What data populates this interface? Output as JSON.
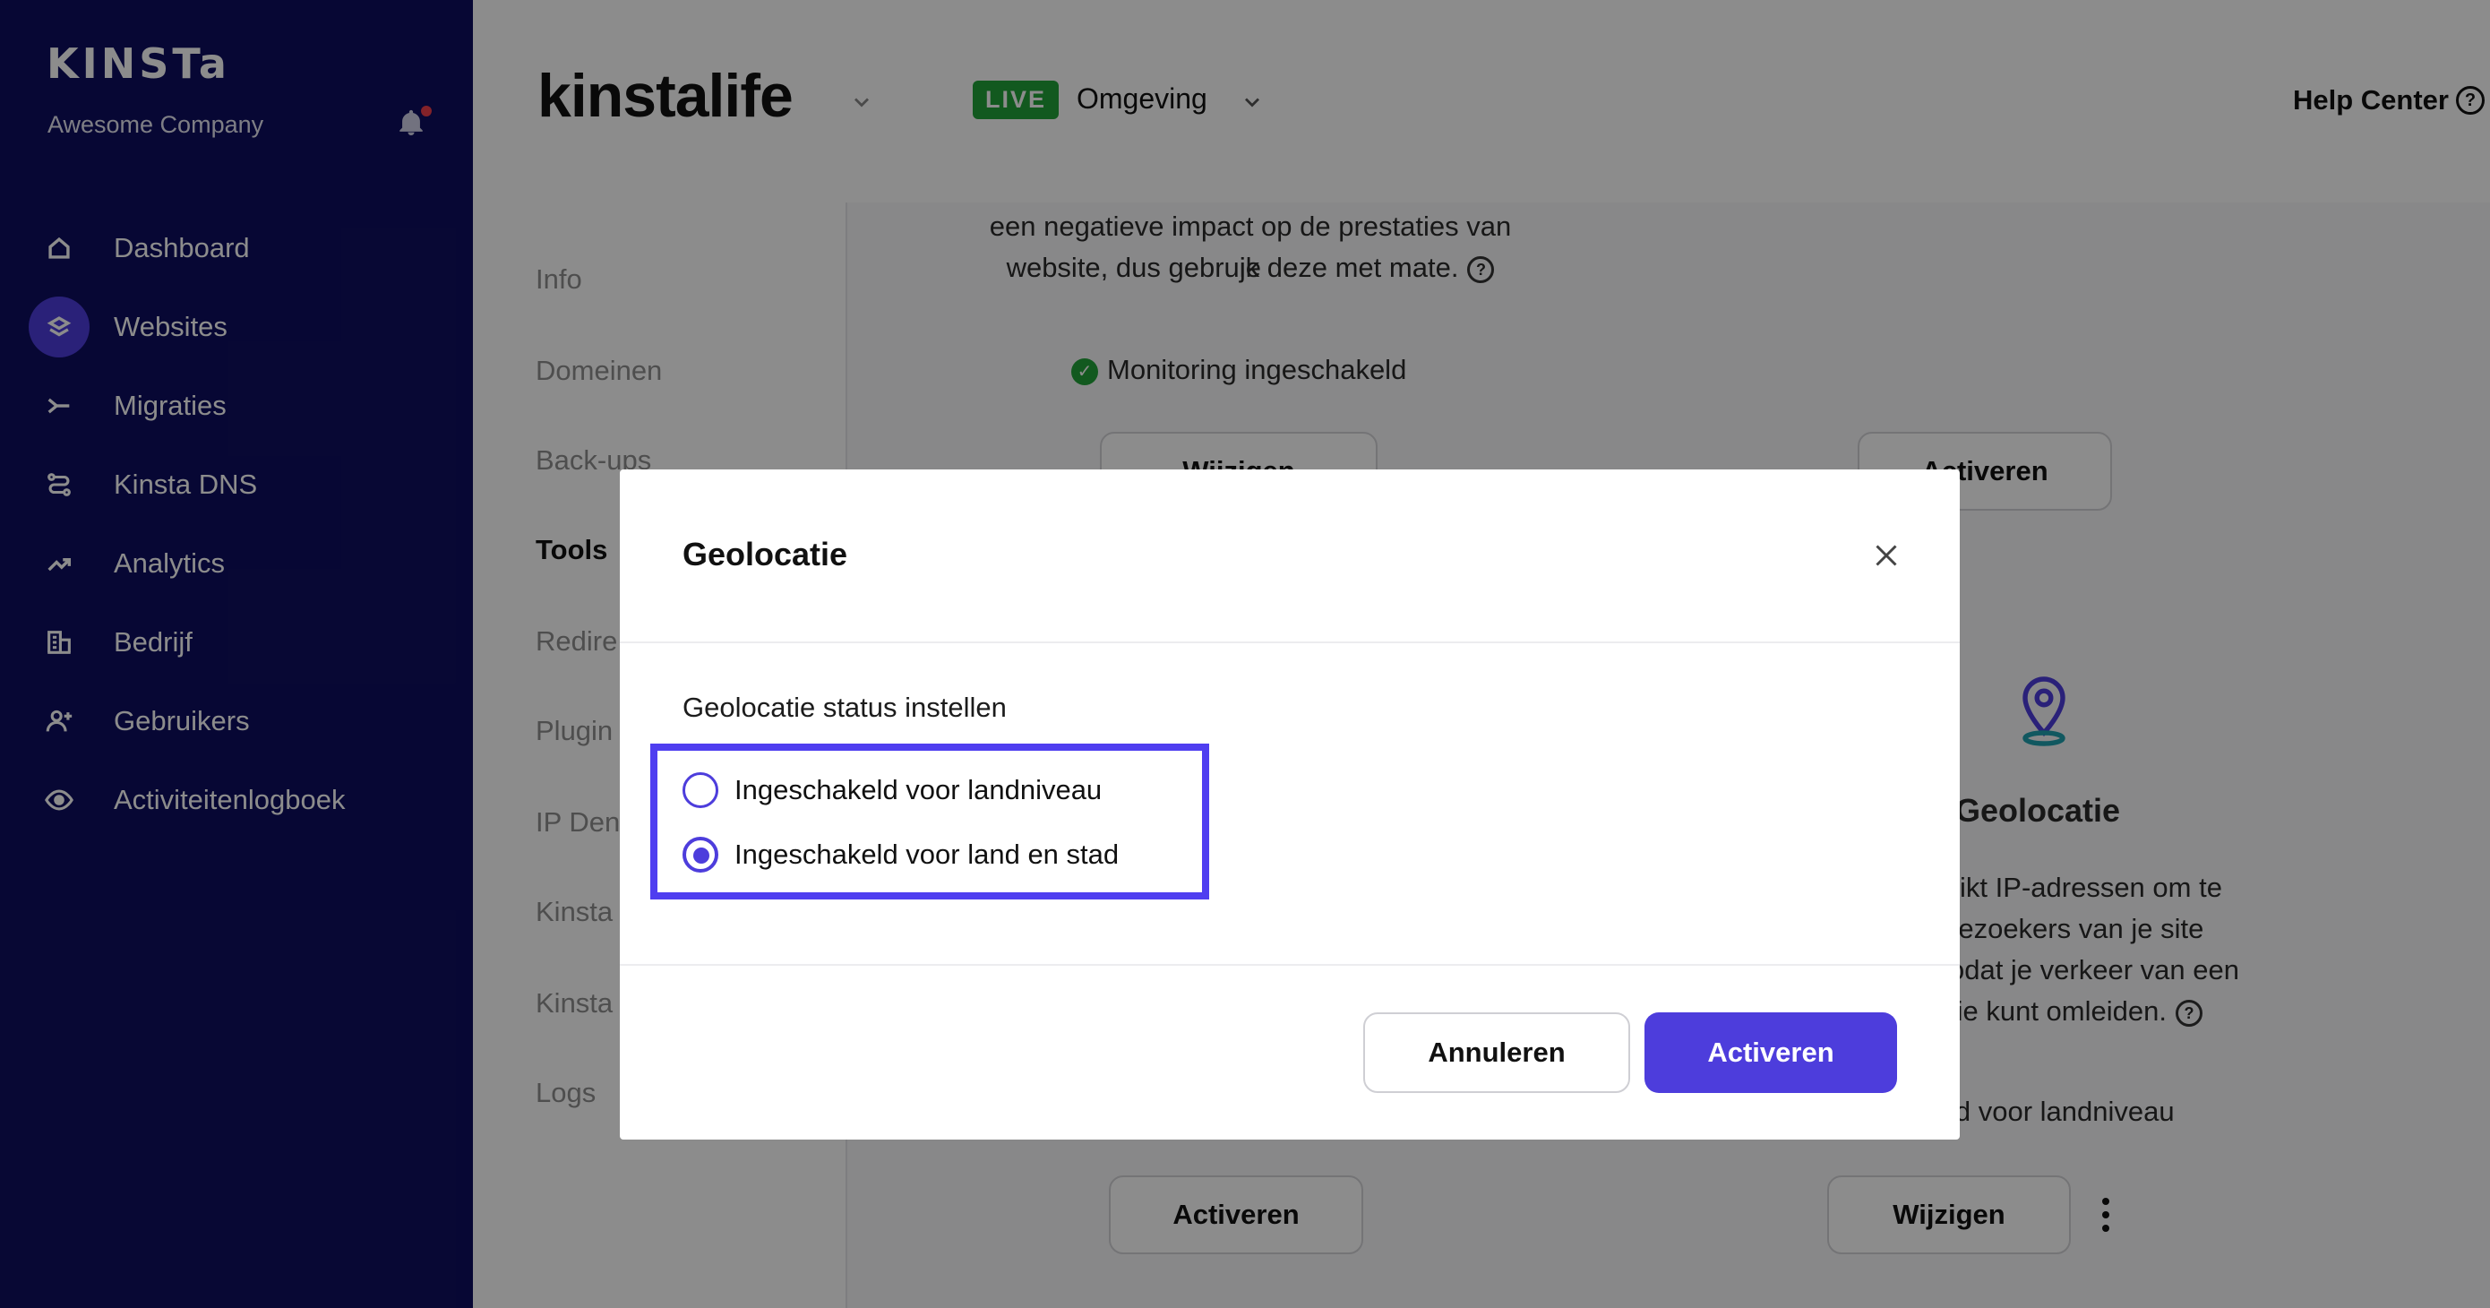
{
  "sidebar": {
    "logo": "KINSTa",
    "company": "Awesome Company",
    "items": [
      {
        "label": "Dashboard",
        "icon": "home-icon"
      },
      {
        "label": "Websites",
        "icon": "layers-icon",
        "active": true
      },
      {
        "label": "Migraties",
        "icon": "migrate-icon"
      },
      {
        "label": "Kinsta DNS",
        "icon": "dns-icon"
      },
      {
        "label": "Analytics",
        "icon": "trend-icon"
      },
      {
        "label": "Bedrijf",
        "icon": "building-icon"
      },
      {
        "label": "Gebruikers",
        "icon": "user-add-icon"
      },
      {
        "label": "Activiteitenlogboek",
        "icon": "eye-icon"
      }
    ]
  },
  "header": {
    "site_name": "kinstalife",
    "env_badge": "LIVE",
    "env_label": "Omgeving",
    "help": "Help Center",
    "help_icon": "?"
  },
  "subnav": {
    "items": [
      "Info",
      "Domeinen",
      "Back-ups",
      "Tools",
      "Redire",
      "Plugin",
      "IP Den",
      "Kinsta",
      "Kinsta",
      "Logs"
    ],
    "active": "Tools"
  },
  "background": {
    "desc_line1": "een negatieve impact op de prestaties van je",
    "desc_line2": "website, dus gebruik deze met mate.",
    "monitoring": "Monitoring ingeschakeld",
    "btn_wijzigen_top": "Wijzigen",
    "btn_activeren_top": "Activeren",
    "geo_title": "Geolocatie",
    "geo_desc1": "ebruikt IP-adressen om te",
    "geo_desc2": "de bezoekers van je site",
    "geo_desc3": "n, zodat je verkeer van een",
    "geo_desc4": "ocatie kunt omleiden.",
    "geo_status": "akeld voor landniveau",
    "btn_activeren_bottom": "Activeren",
    "btn_wijzigen_bottom": "Wijzigen"
  },
  "modal": {
    "title": "Geolocatie",
    "status_label": "Geolocatie status instellen",
    "options": [
      {
        "label": "Ingeschakeld voor landniveau",
        "checked": false
      },
      {
        "label": "Ingeschakeld voor land en stad",
        "checked": true
      }
    ],
    "cancel": "Annuleren",
    "activate": "Activeren"
  },
  "colors": {
    "sidebar_bg": "#0e0e5f",
    "accent": "#4d3ddc",
    "highlight_box": "#4f3ef0",
    "live_green": "#22a33a"
  }
}
